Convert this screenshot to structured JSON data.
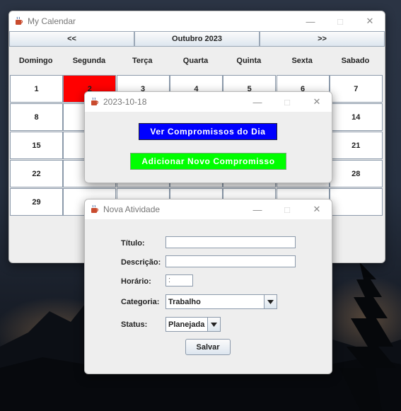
{
  "calendar": {
    "title": "My Calendar",
    "nav": {
      "prev_label": "<<",
      "month_label": "Outubro 2023",
      "next_label": ">>"
    },
    "day_names": [
      "Domingo",
      "Segunda",
      "Terça",
      "Quarta",
      "Quinta",
      "Sexta",
      "Sabado"
    ],
    "weeks": [
      [
        "1",
        "2",
        "3",
        "4",
        "5",
        "6",
        "7"
      ],
      [
        "8",
        "",
        "",
        "",
        "",
        "",
        "14"
      ],
      [
        "15",
        "",
        "",
        "",
        "",
        "",
        "21"
      ],
      [
        "22",
        "",
        "",
        "",
        "",
        "",
        "28"
      ],
      [
        "29",
        "",
        "",
        "",
        "",
        "",
        ""
      ]
    ],
    "highlight_color": "#ff0000"
  },
  "day_dialog": {
    "title": "2023-10-18",
    "view_button": "Ver Compromissos do Dia",
    "add_button": "Adicionar Novo Compromisso",
    "view_color": "#0000ff",
    "add_color": "#00ff00"
  },
  "activity_dialog": {
    "title": "Nova Atividade",
    "title_label": "Título:",
    "title_value": "",
    "description_label": "Descrição:",
    "description_value": "",
    "time_label": "Horário:",
    "time_value": " :",
    "category_label": "Categoria:",
    "category_value": "Trabalho",
    "status_label": "Status:",
    "status_value": "Planejada",
    "save_button": "Salvar"
  },
  "icons": {
    "app": "java-cup-icon",
    "minimize": "minimize-icon",
    "maximize": "maximize-icon",
    "close": "close-icon",
    "dropdown": "chevron-down-icon"
  }
}
